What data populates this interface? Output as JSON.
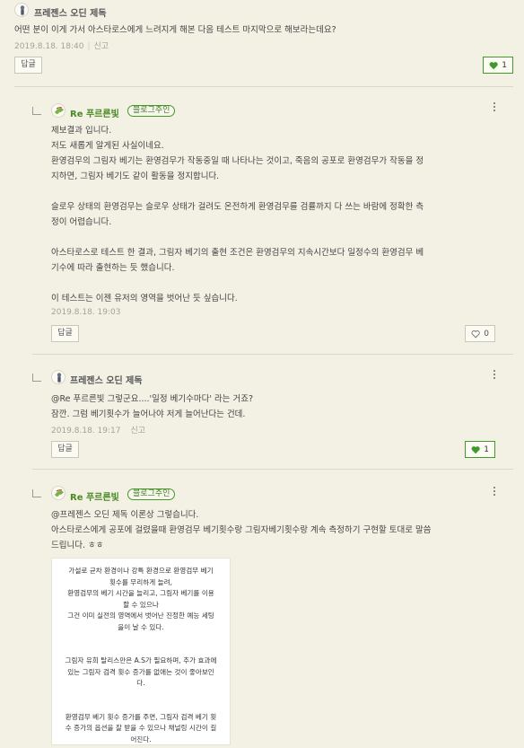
{
  "comment1": {
    "author": "프레젠스 오딘 제독",
    "text": "어떤 분이 이게 가서 아스타로스에게 느려지게 해본 다음 테스트 마지막으로 해보라는데요?",
    "date": "2019.8.18. 18:40",
    "report": "신고",
    "reply_label": "답글",
    "likes": "1"
  },
  "reply1": {
    "author": "Re 푸르른빛",
    "badge": "블로그주인",
    "lines": [
      "제보결과 입니다.",
      "저도 새롭게 알게된 사실이네요.",
      "환영검무의 그림자 베기는 환영검무가 작동중일 때 나타나는 것이고, 죽음의 공포로 환영검무가 작동을 정",
      "지하면, 그림자 베기도 같이 활동을 정지합니다.",
      "",
      "슬로우 상태의 환영검무는 슬로우 상태가 걸려도 온전하게 환영검무를 검률까지 다 쓰는 바람에 정확한 측",
      "정이 어렵습니다.",
      "",
      "아스타로스로 테스트 한 결과, 그림자 베기의 출현 조건은 환영검무의 지속시간보다 일정수의 환영검무 베",
      "기수에 따라 출현하는 듯 했습니다.",
      "",
      "이 테스트는 이젠 유저의 영역을 벗어난 듯 싶습니다."
    ],
    "date": "2019.8.18. 19:03",
    "reply_label": "답글",
    "likes": "0"
  },
  "reply2": {
    "author": "프레젠스 오딘 제독",
    "lines": [
      "@Re 푸르른빛 그렇군요....'일정 베기수마다' 라는 거죠?",
      "잠깐. 그럼 베기횟수가 늘어나야 저게 늘어난다는 건데."
    ],
    "date": "2019.8.18. 19:17",
    "report": "신고",
    "reply_label": "답글",
    "likes": "1"
  },
  "reply3": {
    "author": "Re 푸르른빛",
    "badge": "블로그주인",
    "lines": [
      "@프레젠스 오딘 제독 이론상 그렇습니다.",
      "아스타로스에게 공포에 걸렸을때 환영검무 베기횟수랑 그림자베기횟수랑 계속 측정하기 구현할 토대로 말씀",
      "드립니다. ㅎㅎ"
    ],
    "image_lines": [
      "가설로 균차 환경이나 강특 환경으로 환영검무 베기",
      "횟수를 무리하게 늘려,",
      "환영검무의 베기 시간을 늘리고, 그림자 베기를 이용",
      "할 수 있으나",
      "그건 이미 실전의 영역에서 벗어난 진정한 예능 세팅",
      "을이 날 수 있다.",
      "",
      "",
      "그림자 유희 탈리스만은 A.S가 필요하며, 추가 효과에",
      "있는 그림자 검격 횟수 증가를 없애는 것이 좋아보인",
      "다.",
      "",
      "",
      "환영검무 베기 횟수 증가를 주면, 그림자 검격 베기 횟",
      "수 증가의 옵션을 잘 받을 수 있으나 채널링 시간이 길",
      "어진다."
    ]
  },
  "colors": {
    "background": "#f3f1e4",
    "accent_green": "#3f9a2a",
    "badge_green": "#3d7f1f"
  }
}
